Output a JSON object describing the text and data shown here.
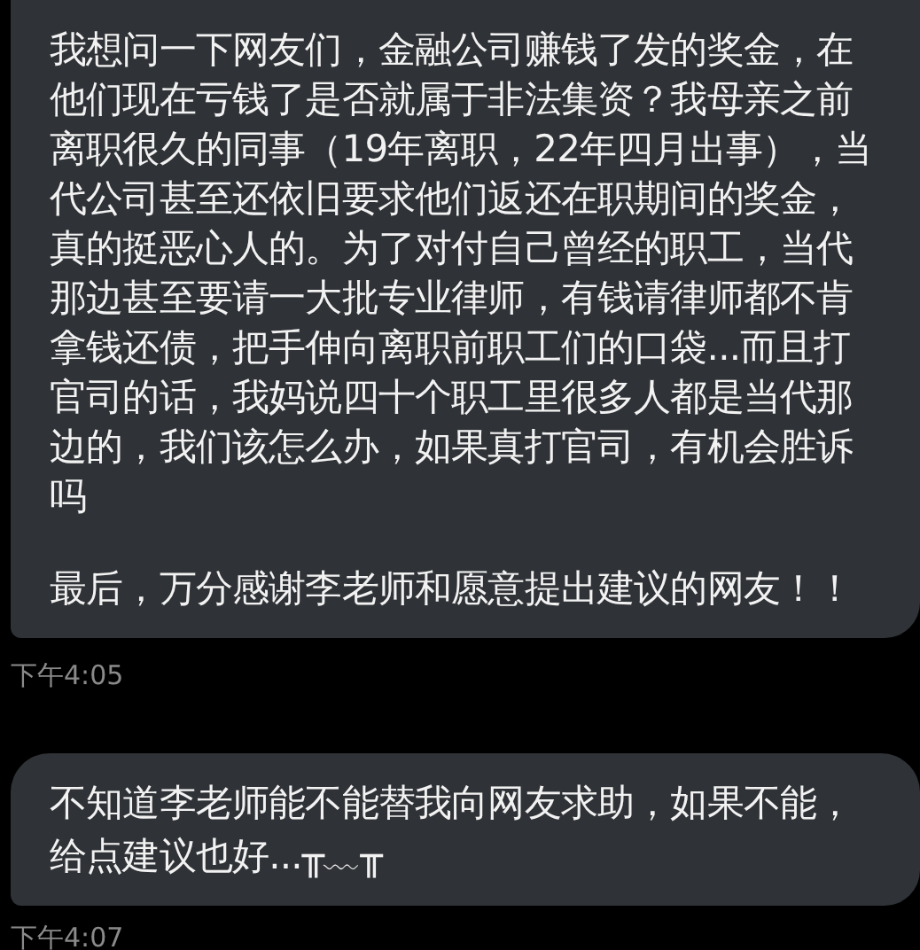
{
  "messages": [
    {
      "paragraphs": [
        "我想问一下网友们，金融公司赚钱了发的奖金，在他们现在亏钱了是否就属于非法集资？我母亲之前离职很久的同事（19年离职，22年四月出事），当代公司甚至还依旧要求他们返还在职期间的奖金，真的挺恶心人的。为了对付自己曾经的职工，当代那边甚至要请一大批专业律师，有钱请律师都不肯拿钱还债，把手伸向离职前职工们的口袋...而且打官司的话，我妈说四十个职工里很多人都是当代那边的，我们该怎么办，如果真打官司，有机会胜诉吗",
        "最后，万分感谢李老师和愿意提出建议的网友！！"
      ],
      "time": "下午4:05"
    },
    {
      "paragraphs": [
        "不知道李老师能不能替我向网友求助，如果不能，给点建议也好...╥﹏╥"
      ],
      "time": "下午4:07"
    }
  ]
}
